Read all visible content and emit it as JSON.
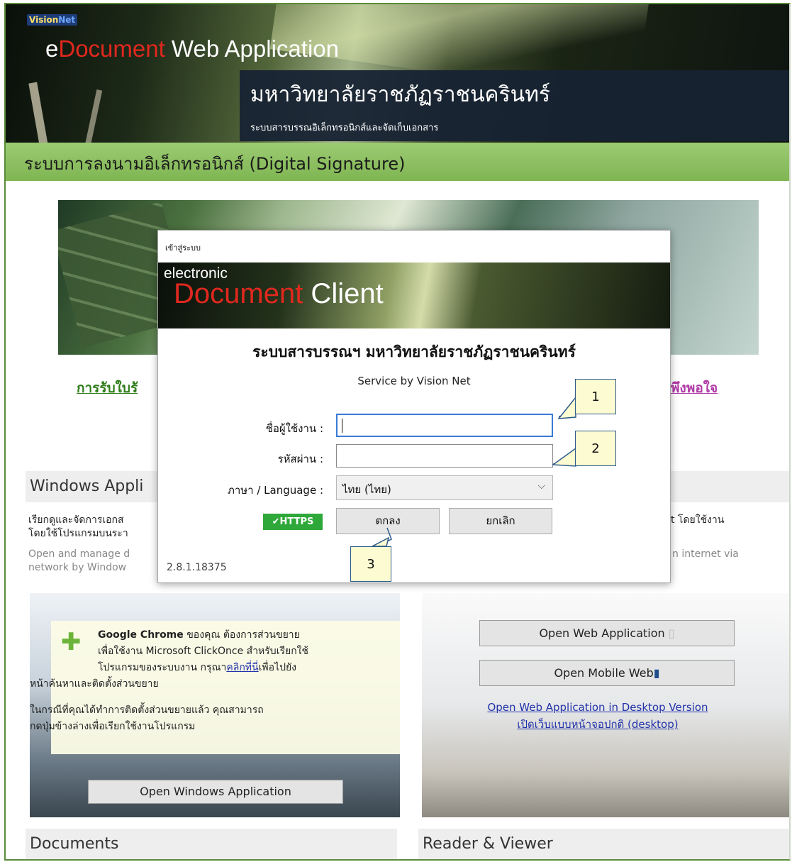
{
  "header": {
    "logo_left": "Vision",
    "logo_right": "Net",
    "app_title_prefix": "e",
    "app_title_red": "Document",
    "app_title_rest": " Web Application",
    "university": "มหาวิทยาลัยราชภัฏราชนครินทร์",
    "subtitle": "ระบบสารบรรณอิเล็กทรอนิกส์และจัดเก็บเอกสาร",
    "section_bar": "ระบบการลงนามอิเล็กทรอนิกส์ (Digital Signature)"
  },
  "links": {
    "left": "การรับใบรั",
    "right": "พึงพอใจ"
  },
  "windows_section": {
    "title": "Windows Appli",
    "desc_th_1": "เรียกดูและจัดการเอกส",
    "desc_th_2": "โดยใช้โปรแกรมบนระา",
    "desc_en_1": "Open and manage d",
    "desc_en_2": "network by Window",
    "chrome_name": "Google Chrome",
    "chrome_line1_rest": " ของคุณ ต้องการส่วนขยาย",
    "chrome_line2": "เพื่อใช้งาน Microsoft ClickOnce สำหรับเรียกใช้",
    "chrome_line3_pre": "โปรแกรมของระบบงาน กรุณา",
    "chrome_line3_link": "คลิกที่นี่",
    "chrome_line3_post": "เพื่อไปยัง",
    "chrome_line4": "หน้าค้นหาและติดตั้งส่วนขยาย",
    "chrome_line5": "ในกรณีที่คุณได้ทำการติดตั้งส่วนขยายแล้ว คุณสามารถ",
    "chrome_line6": "กดปุ่มข้างล่างเพื่อเรียกใช้งานโปรแกรม",
    "open_windows_button": "Open Windows Application"
  },
  "web_section": {
    "desc_th_1": "t โดยใช้งาน",
    "desc_en_1": "n internet via",
    "open_web_button": "Open Web Application",
    "open_mobile_button": "Open Mobile Web",
    "desktop_link_1": "Open Web Application in Desktop Version",
    "desktop_link_2": "เปิดเว็บแบบหน้าจอปกติ (desktop)"
  },
  "bottom": {
    "documents": "Documents",
    "reader": "Reader & Viewer"
  },
  "dialog": {
    "title": "เข้าสู่ระบบ",
    "banner_small": "electronic",
    "banner_red": "Document",
    "banner_white": " Client",
    "heading": "ระบบสารบรรณฯ มหาวิทยาลัยราชภัฏราชนครินทร์",
    "service": "Service by Vision Net",
    "username_label": "ชื่อผู้ใช้งาน :",
    "username_value": "",
    "password_label": "รหัสผ่าน :",
    "password_value": "",
    "language_label": "ภาษา / Language :",
    "language_value": "ไทย (ไทย)",
    "https_badge": "✔HTTPS",
    "ok_button": "ตกลง",
    "cancel_button": "ยกเลิก",
    "version": "2.8.1.18375"
  },
  "callouts": [
    "1",
    "2",
    "3"
  ],
  "colors": {
    "green_bar": "#7fb552",
    "https_green": "#2fa83a",
    "brand_red": "#e0281e",
    "link_blue": "#2233aa",
    "focus_blue": "#3a7bd5",
    "callout_fill": "#fdfbd2"
  }
}
